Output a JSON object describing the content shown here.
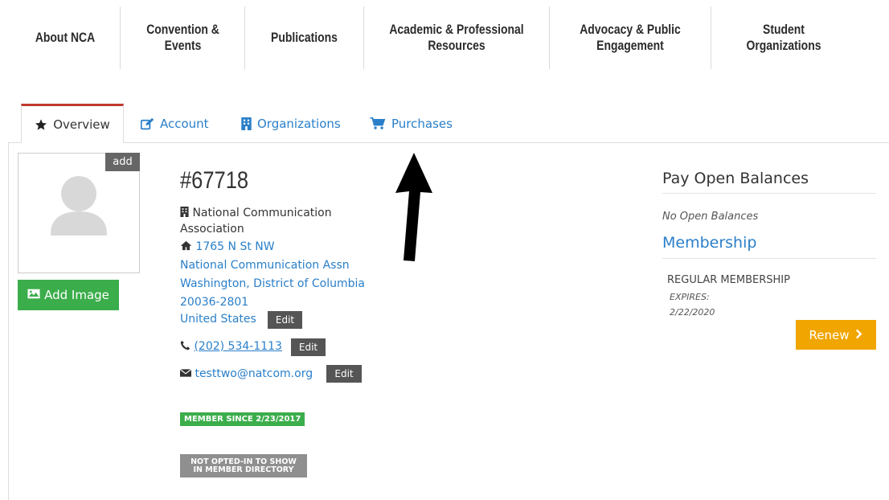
{
  "nav": {
    "items": [
      {
        "label": "About NCA"
      },
      {
        "label": "Convention &\nEvents"
      },
      {
        "label": "Publications"
      },
      {
        "label": "Academic & Professional\nResources"
      },
      {
        "label": "Advocacy & Public\nEngagement"
      },
      {
        "label": "Student\nOrganizations"
      }
    ]
  },
  "tabs": [
    {
      "label": "Overview",
      "icon": "star-icon",
      "active": true
    },
    {
      "label": "Account",
      "icon": "edit-icon"
    },
    {
      "label": "Organizations",
      "icon": "building-icon"
    },
    {
      "label": "Purchases",
      "icon": "cart-icon"
    }
  ],
  "profile": {
    "add_label": "add",
    "add_image_label": "Add Image",
    "member_id": "#67718",
    "organization": "National Communication Association",
    "address": {
      "line1": "1765 N St NW",
      "line2": "National Communication Assn",
      "line3": "Washington, District of Columbia",
      "line4": "20036-2801",
      "country": "United States"
    },
    "phone": "(202) 534-1113",
    "email": "testtwo@natcom.org",
    "edit_label": "Edit",
    "member_since": "MEMBER SINCE 2/23/2017",
    "directory_status": "NOT OPTED-IN TO SHOW\nIN MEMBER DIRECTORY"
  },
  "sidebar": {
    "balances_title": "Pay Open Balances",
    "balances_status": "No Open Balances",
    "membership_title": "Membership",
    "membership_type": "REGULAR MEMBERSHIP",
    "expires_label": "EXPIRES:",
    "expires_date": "2/22/2020",
    "renew_label": "Renew"
  },
  "colors": {
    "link": "#2a7fc9",
    "green": "#3bad4b",
    "orange": "#f0a500",
    "active_tab": "#c0392b"
  }
}
